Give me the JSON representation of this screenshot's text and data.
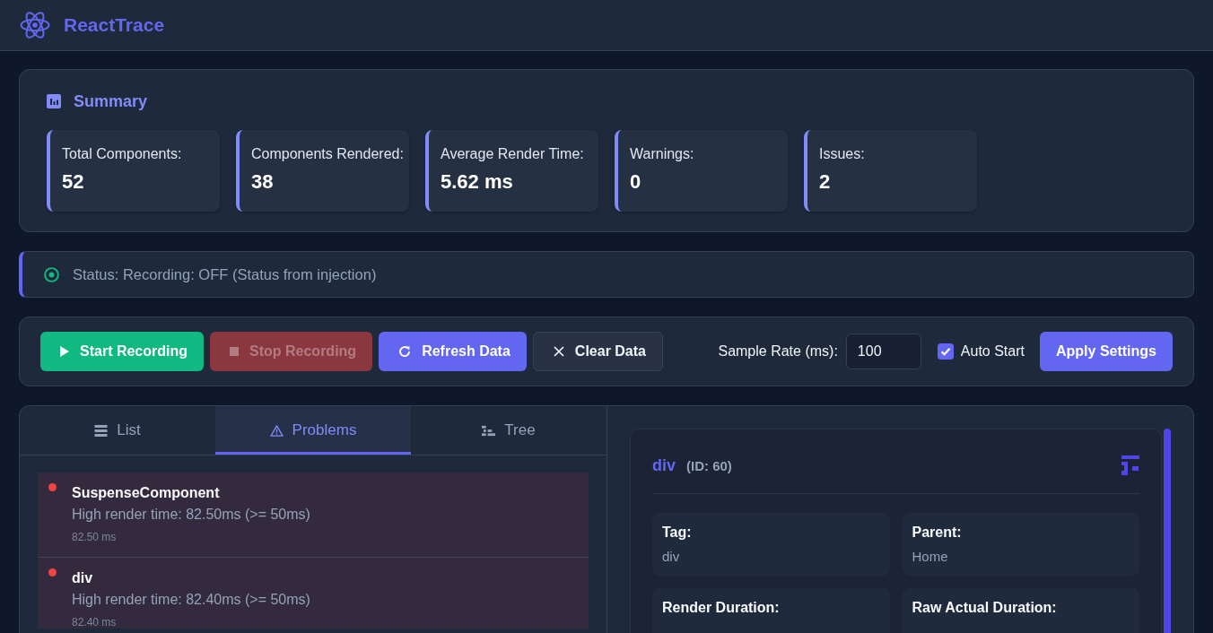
{
  "header": {
    "title": "ReactTrace"
  },
  "summary": {
    "title": "Summary",
    "stats": [
      {
        "label": "Total Components:",
        "value": "52"
      },
      {
        "label": "Components Rendered:",
        "value": "38"
      },
      {
        "label": "Average Render Time:",
        "value": "5.62 ms"
      },
      {
        "label": "Warnings:",
        "value": "0"
      },
      {
        "label": "Issues:",
        "value": "2"
      }
    ]
  },
  "status": {
    "text": "Status: Recording: OFF (Status from injection)"
  },
  "controls": {
    "buttons": [
      {
        "label": "Start Recording",
        "kind": "start",
        "disabled": false
      },
      {
        "label": "Stop Recording",
        "kind": "stop",
        "disabled": true
      },
      {
        "label": "Refresh Data",
        "kind": "refresh",
        "disabled": false
      },
      {
        "label": "Clear Data",
        "kind": "clear",
        "disabled": false
      }
    ],
    "sample_rate": {
      "label": "Sample Rate (ms):",
      "value": "100"
    },
    "auto_start": {
      "label": "Auto Start",
      "checked": true
    },
    "apply_button": {
      "label": "Apply Settings"
    }
  },
  "tabs": [
    {
      "label": "List",
      "kind": "list",
      "selected": false
    },
    {
      "label": "Problems",
      "kind": "problems",
      "selected": true
    },
    {
      "label": "Tree",
      "kind": "tree",
      "selected": false
    }
  ],
  "problems": [
    {
      "name": "SuspenseComponent",
      "message": "High render time: 82.50ms (>= 50ms)",
      "duration": "82.50 ms"
    },
    {
      "name": "div",
      "message": "High render time: 82.40ms (>= 50ms)",
      "duration": "82.40 ms"
    }
  ],
  "details": {
    "name": "div",
    "id": "(ID: 60)",
    "fields": [
      {
        "label": "Tag:",
        "value": "div"
      },
      {
        "label": "Parent:",
        "value": "Home"
      },
      {
        "label": "Render Duration:"
      },
      {
        "label": "Raw Actual Duration:"
      }
    ]
  }
}
